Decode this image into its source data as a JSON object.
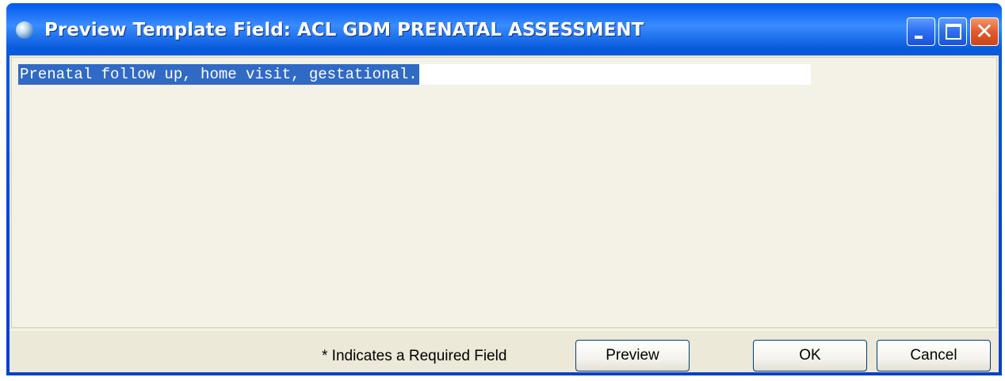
{
  "window": {
    "title": "Preview Template Field: ACL GDM PRENATAL ASSESSMENT",
    "minimize_label": "",
    "maximize_label": "",
    "close_label": "✕"
  },
  "memo": {
    "selected_text": "Prenatal follow up, home visit, gestational."
  },
  "footer": {
    "required_note": "* Indicates a Required Field",
    "preview_label": "Preview",
    "ok_label": "OK",
    "cancel_label": "Cancel"
  },
  "colors": {
    "titlebar": "#0046d5",
    "selection": "#316ac5",
    "client_bg": "#ece9d8",
    "close_button": "#e25a2a"
  }
}
